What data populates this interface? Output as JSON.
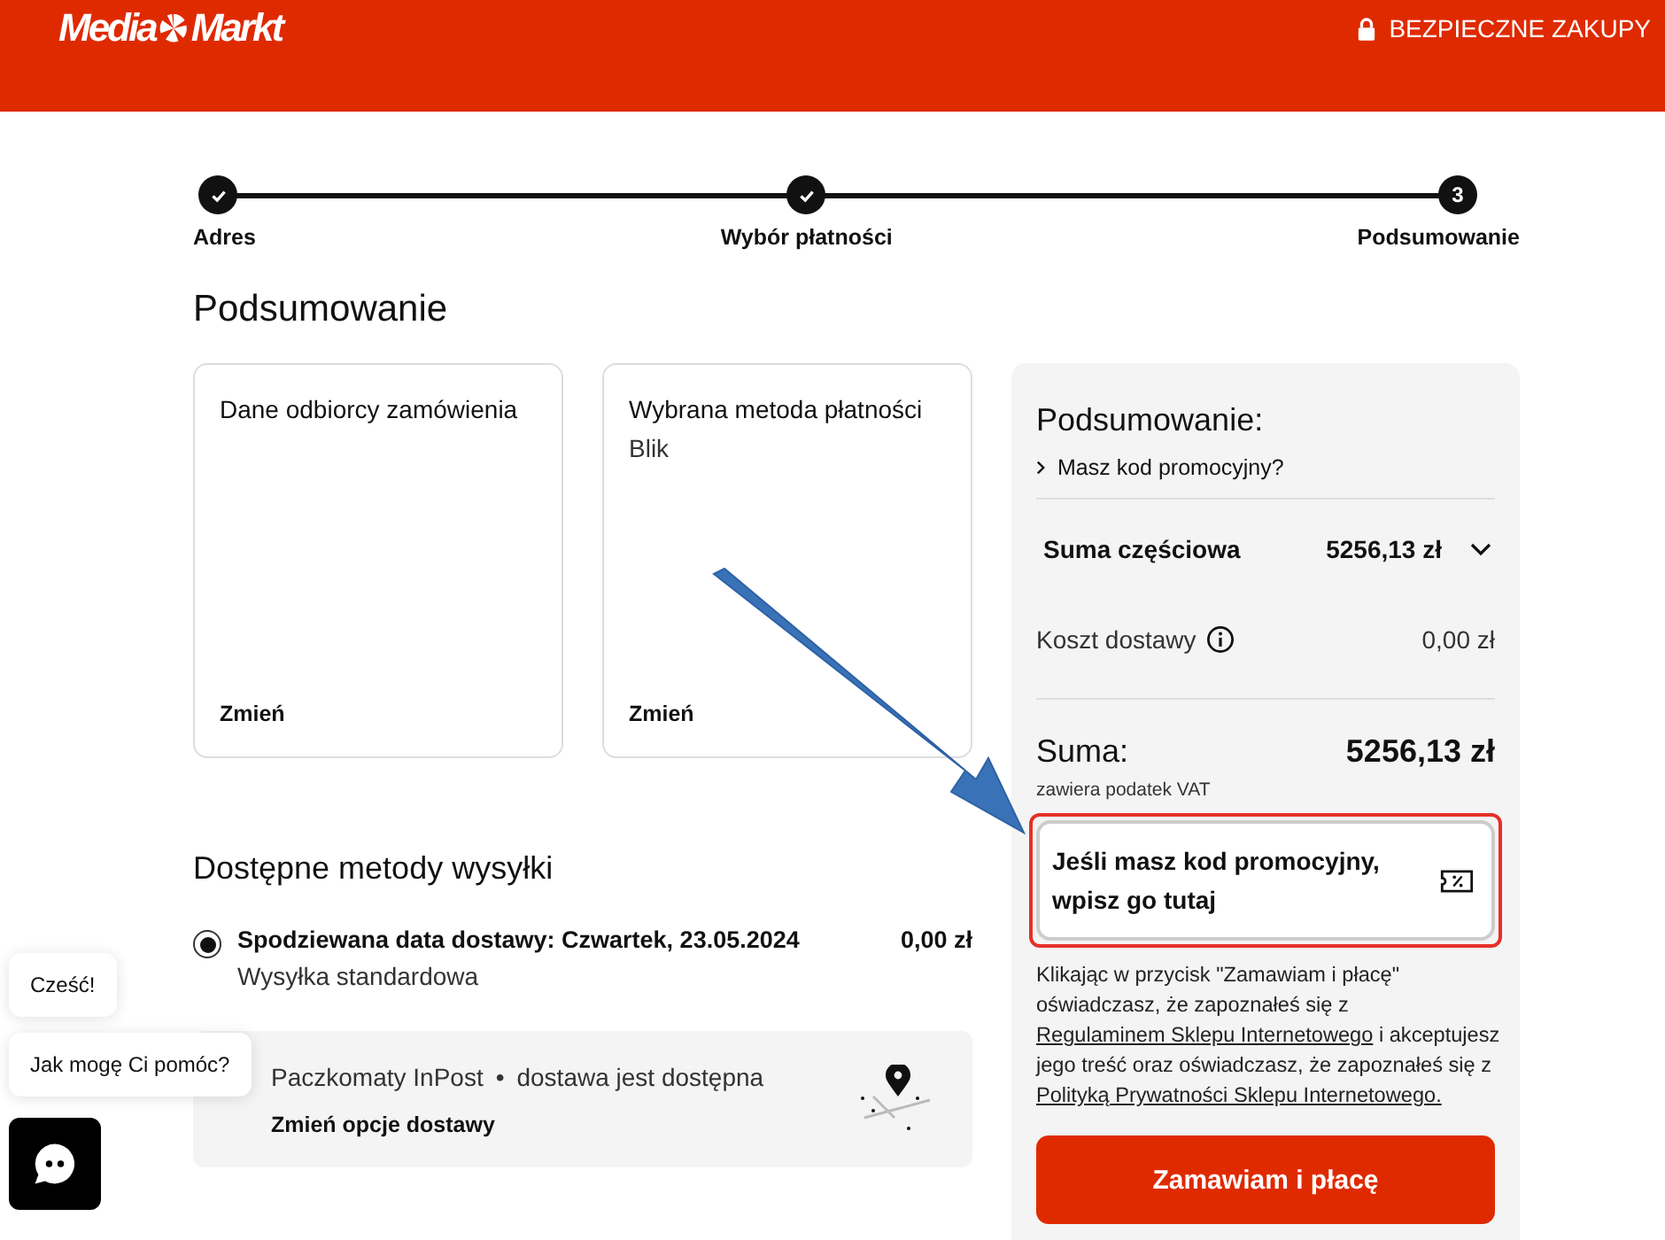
{
  "header": {
    "logo": {
      "part1": "Media",
      "part2": "Markt"
    },
    "secure_label": "BEZPIECZNE ZAKUPY"
  },
  "steps": [
    {
      "label": "Adres",
      "completed": true
    },
    {
      "label": "Wybór płatności",
      "completed": true
    },
    {
      "label": "Podsumowanie",
      "completed": false,
      "number": "3"
    }
  ],
  "page_title": "Podsumowanie",
  "cards": [
    {
      "title": "Dane odbiorcy zamówienia",
      "link": "Zmień"
    },
    {
      "title": "Wybrana metoda płatności",
      "value": "Blik",
      "link": "Zmień"
    }
  ],
  "shipping": {
    "title": "Dostępne metody wysyłki",
    "options": [
      {
        "selected": true,
        "title": "Spodziewana data dostawy: Czwartek, 23.05.2024",
        "price": "0,00 zł",
        "subtitle": "Wysyłka standardowa"
      }
    ],
    "pickup": {
      "name": "Paczkomaty InPost",
      "separator": "•",
      "status": "dostawa jest dostępna",
      "link": "Zmień opcje dostawy"
    }
  },
  "summary": {
    "title": "Podsumowanie:",
    "promo_toggle": "Masz kod promocyjny?",
    "subtotal": {
      "label": "Suma częściowa",
      "value": "5256,13 zł",
      "expanded": false
    },
    "shipping_cost": {
      "label": "Koszt dostawy",
      "value": "0,00 zł"
    },
    "total": {
      "label": "Suma:",
      "value": "5256,13 zł",
      "note": "zawiera podatek VAT"
    },
    "promo_field": {
      "placeholder": "Jeśli masz kod promocyjny, wpisz go tutaj",
      "highlighted": true
    },
    "consent": {
      "text1": "Klikając w przycisk \"Zamawiam i płacę\" oświadczasz, że zapoznałeś się z",
      "link1": "Regulaminem Sklepu Internetowego",
      "text2": "i akceptujesz jego treść oraz oświadczasz, że zapoznałeś się z",
      "link2": "Polityką Prywatności Sklepu Internetowego."
    },
    "button": "Zamawiam i płacę"
  },
  "chat": {
    "messages": [
      "Cześć!",
      "Jak mogę Ci pomóc?"
    ]
  }
}
